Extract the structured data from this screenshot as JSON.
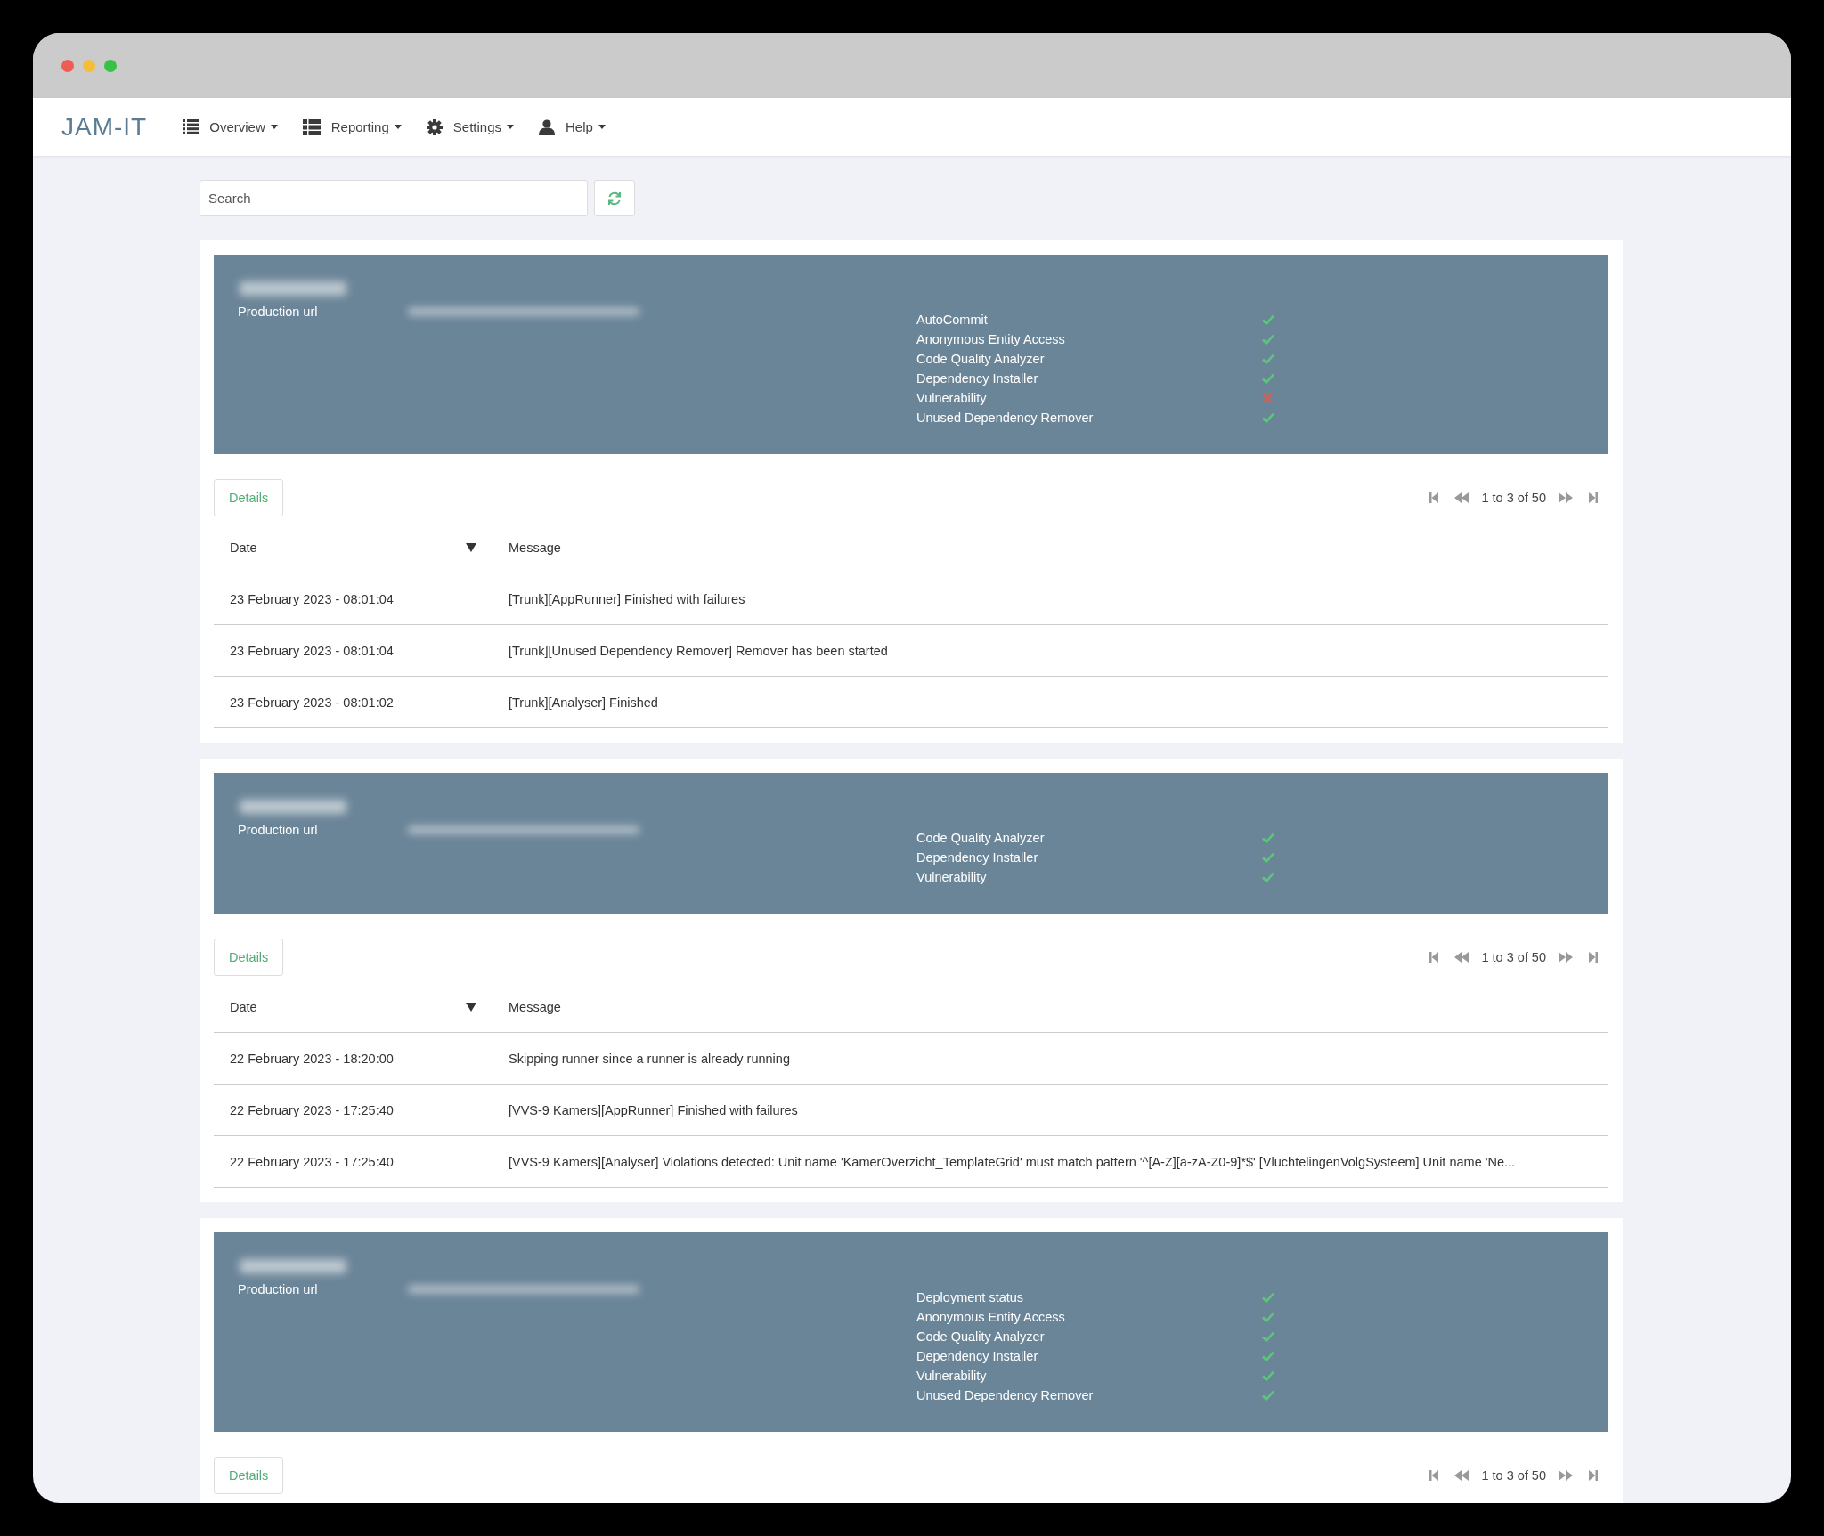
{
  "nav": {
    "logo": "JAM-IT",
    "menus": [
      {
        "label": "Overview"
      },
      {
        "label": "Reporting"
      },
      {
        "label": "Settings"
      },
      {
        "label": "Help"
      }
    ]
  },
  "search": {
    "placeholder": "Search"
  },
  "projects": [
    {
      "url_label": "Production url",
      "checks": [
        {
          "name": "AutoCommit",
          "passed": true
        },
        {
          "name": "Anonymous Entity Access",
          "passed": true
        },
        {
          "name": "Code Quality Analyzer",
          "passed": true
        },
        {
          "name": "Dependency Installer",
          "passed": true
        },
        {
          "name": "Vulnerability",
          "passed": false
        },
        {
          "name": "Unused Dependency Remover",
          "passed": true
        }
      ],
      "details": "Details",
      "pager": "1 to 3 of 50",
      "columns": [
        "Date",
        "Message"
      ],
      "rows": [
        {
          "date": "23 February 2023 - 08:01:04",
          "message": "[Trunk][AppRunner] Finished with failures"
        },
        {
          "date": "23 February 2023 - 08:01:04",
          "message": "[Trunk][Unused Dependency Remover] Remover has been started"
        },
        {
          "date": "23 February 2023 - 08:01:02",
          "message": "[Trunk][Analyser] Finished"
        }
      ]
    },
    {
      "url_label": "Production url",
      "checks": [
        {
          "name": "Code Quality Analyzer",
          "passed": true
        },
        {
          "name": "Dependency Installer",
          "passed": true
        },
        {
          "name": "Vulnerability",
          "passed": true
        }
      ],
      "details": "Details",
      "pager": "1 to 3 of 50",
      "columns": [
        "Date",
        "Message"
      ],
      "rows": [
        {
          "date": "22 February 2023 - 18:20:00",
          "message": "Skipping runner since a runner is already running"
        },
        {
          "date": "22 February 2023 - 17:25:40",
          "message": "[VVS-9 Kamers][AppRunner] Finished with failures"
        },
        {
          "date": "22 February 2023 - 17:25:40",
          "message": "[VVS-9 Kamers][Analyser] Violations detected: Unit name 'KamerOverzicht_TemplateGrid' must match pattern '^[A-Z][a-zA-Z0-9]*$' [VluchtelingenVolgSysteem] Unit name 'Ne..."
        }
      ]
    },
    {
      "url_label": "Production url",
      "checks": [
        {
          "name": "Deployment status",
          "passed": true
        },
        {
          "name": "Anonymous Entity Access",
          "passed": true
        },
        {
          "name": "Code Quality Analyzer",
          "passed": true
        },
        {
          "name": "Dependency Installer",
          "passed": true
        },
        {
          "name": "Vulnerability",
          "passed": true
        },
        {
          "name": "Unused Dependency Remover",
          "passed": true
        }
      ],
      "details": "Details",
      "pager": "1 to 3 of 50"
    }
  ]
}
